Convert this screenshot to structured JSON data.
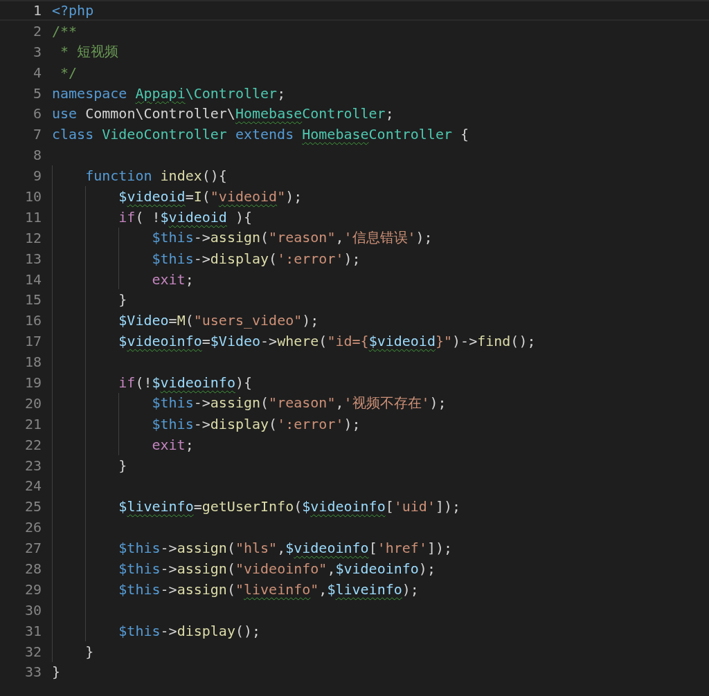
{
  "editor": {
    "lines": [
      {
        "number": "1",
        "current": true,
        "tokens": [
          {
            "text": "<?php",
            "kind": "kw"
          }
        ]
      },
      {
        "number": "2",
        "current": false,
        "tokens": [
          {
            "text": "/**",
            "kind": "cmt"
          }
        ]
      },
      {
        "number": "3",
        "current": false,
        "tokens": [
          {
            "text": " * 短视频",
            "kind": "cmt"
          }
        ]
      },
      {
        "number": "4",
        "current": false,
        "tokens": [
          {
            "text": " */",
            "kind": "cmt"
          }
        ]
      },
      {
        "number": "5",
        "current": false,
        "tokens": [
          {
            "text": "namespace ",
            "kind": "kw"
          },
          {
            "text": "Appapi",
            "kind": "cls",
            "squiggle": true
          },
          {
            "text": "\\Controller",
            "kind": "cls"
          },
          {
            "text": ";",
            "kind": "plain"
          }
        ]
      },
      {
        "number": "6",
        "current": false,
        "tokens": [
          {
            "text": "use ",
            "kind": "kw"
          },
          {
            "text": "Common\\Controller\\",
            "kind": "plain"
          },
          {
            "text": "Homebase",
            "kind": "cls",
            "squiggle": true
          },
          {
            "text": "Controller",
            "kind": "cls"
          },
          {
            "text": ";",
            "kind": "plain"
          }
        ]
      },
      {
        "number": "7",
        "current": false,
        "tokens": [
          {
            "text": "class ",
            "kind": "kw"
          },
          {
            "text": "VideoController ",
            "kind": "cls"
          },
          {
            "text": "extends ",
            "kind": "kw"
          },
          {
            "text": "Homebase",
            "kind": "cls",
            "squiggle": true
          },
          {
            "text": "Controller",
            "kind": "cls"
          },
          {
            "text": " {",
            "kind": "plain"
          }
        ]
      },
      {
        "number": "8",
        "current": false
      },
      {
        "number": "9",
        "current": false,
        "tokens": [
          {
            "text": "    function ",
            "kind": "kw"
          },
          {
            "text": "index",
            "kind": "fn"
          },
          {
            "text": "(){",
            "kind": "plain"
          }
        ]
      },
      {
        "number": "10",
        "current": false,
        "tokens": [
          {
            "text": "        $",
            "kind": "var"
          },
          {
            "text": "videoid",
            "kind": "var",
            "squiggle": true
          },
          {
            "text": "=",
            "kind": "plain"
          },
          {
            "text": "I",
            "kind": "fn"
          },
          {
            "text": "(",
            "kind": "plain"
          },
          {
            "text": "\"",
            "kind": "str"
          },
          {
            "text": "videoid",
            "kind": "str",
            "squiggle": true
          },
          {
            "text": "\"",
            "kind": "str"
          },
          {
            "text": ");",
            "kind": "plain"
          }
        ]
      },
      {
        "number": "11",
        "current": false,
        "tokens": [
          {
            "text": "        if",
            "kind": "ctl"
          },
          {
            "text": "( !",
            "kind": "plain"
          },
          {
            "text": "$",
            "kind": "var"
          },
          {
            "text": "videoid",
            "kind": "var",
            "squiggle": true
          },
          {
            "text": " ){",
            "kind": "plain"
          }
        ]
      },
      {
        "number": "12",
        "current": false,
        "tokens": [
          {
            "text": "            $this",
            "kind": "kw"
          },
          {
            "text": "->",
            "kind": "plain"
          },
          {
            "text": "assign",
            "kind": "fn"
          },
          {
            "text": "(",
            "kind": "plain"
          },
          {
            "text": "\"reason\"",
            "kind": "str"
          },
          {
            "text": ",",
            "kind": "plain"
          },
          {
            "text": "'信息错误'",
            "kind": "str"
          },
          {
            "text": ");",
            "kind": "plain"
          }
        ]
      },
      {
        "number": "13",
        "current": false,
        "tokens": [
          {
            "text": "            $this",
            "kind": "kw"
          },
          {
            "text": "->",
            "kind": "plain"
          },
          {
            "text": "display",
            "kind": "fn"
          },
          {
            "text": "(",
            "kind": "plain"
          },
          {
            "text": "':error'",
            "kind": "str"
          },
          {
            "text": ");",
            "kind": "plain"
          }
        ]
      },
      {
        "number": "14",
        "current": false,
        "tokens": [
          {
            "text": "            exit",
            "kind": "ctl"
          },
          {
            "text": ";",
            "kind": "plain"
          }
        ]
      },
      {
        "number": "15",
        "current": false,
        "tokens": [
          {
            "text": "        }",
            "kind": "plain"
          }
        ]
      },
      {
        "number": "16",
        "current": false,
        "tokens": [
          {
            "text": "        $Video",
            "kind": "var"
          },
          {
            "text": "=",
            "kind": "plain"
          },
          {
            "text": "M",
            "kind": "fn"
          },
          {
            "text": "(",
            "kind": "plain"
          },
          {
            "text": "\"users_video\"",
            "kind": "str"
          },
          {
            "text": ");",
            "kind": "plain"
          }
        ]
      },
      {
        "number": "17",
        "current": false,
        "tokens": [
          {
            "text": "        $",
            "kind": "var"
          },
          {
            "text": "videoinfo",
            "kind": "var",
            "squiggle": true
          },
          {
            "text": "=",
            "kind": "plain"
          },
          {
            "text": "$Video",
            "kind": "var"
          },
          {
            "text": "->",
            "kind": "plain"
          },
          {
            "text": "where",
            "kind": "fn"
          },
          {
            "text": "(",
            "kind": "plain"
          },
          {
            "text": "\"id={",
            "kind": "str"
          },
          {
            "text": "$videoid",
            "kind": "var",
            "squiggle": true
          },
          {
            "text": "}\"",
            "kind": "str"
          },
          {
            "text": ")->",
            "kind": "plain"
          },
          {
            "text": "find",
            "kind": "fn"
          },
          {
            "text": "();",
            "kind": "plain"
          }
        ]
      },
      {
        "number": "18",
        "current": false
      },
      {
        "number": "19",
        "current": false,
        "tokens": [
          {
            "text": "        if",
            "kind": "ctl"
          },
          {
            "text": "(!",
            "kind": "plain"
          },
          {
            "text": "$",
            "kind": "var"
          },
          {
            "text": "videoinfo",
            "kind": "var",
            "squiggle": true
          },
          {
            "text": "){",
            "kind": "plain"
          }
        ]
      },
      {
        "number": "20",
        "current": false,
        "tokens": [
          {
            "text": "            $this",
            "kind": "kw"
          },
          {
            "text": "->",
            "kind": "plain"
          },
          {
            "text": "assign",
            "kind": "fn"
          },
          {
            "text": "(",
            "kind": "plain"
          },
          {
            "text": "\"reason\"",
            "kind": "str"
          },
          {
            "text": ",",
            "kind": "plain"
          },
          {
            "text": "'视频不存在'",
            "kind": "str"
          },
          {
            "text": ");",
            "kind": "plain"
          }
        ]
      },
      {
        "number": "21",
        "current": false,
        "tokens": [
          {
            "text": "            $this",
            "kind": "kw"
          },
          {
            "text": "->",
            "kind": "plain"
          },
          {
            "text": "display",
            "kind": "fn"
          },
          {
            "text": "(",
            "kind": "plain"
          },
          {
            "text": "':error'",
            "kind": "str"
          },
          {
            "text": ");",
            "kind": "plain"
          }
        ]
      },
      {
        "number": "22",
        "current": false,
        "tokens": [
          {
            "text": "            exit",
            "kind": "ctl"
          },
          {
            "text": ";",
            "kind": "plain"
          }
        ]
      },
      {
        "number": "23",
        "current": false,
        "tokens": [
          {
            "text": "        }",
            "kind": "plain"
          }
        ]
      },
      {
        "number": "24",
        "current": false
      },
      {
        "number": "25",
        "current": false,
        "tokens": [
          {
            "text": "        $",
            "kind": "var"
          },
          {
            "text": "liveinfo",
            "kind": "var",
            "squiggle": true
          },
          {
            "text": "=",
            "kind": "plain"
          },
          {
            "text": "getUserInfo",
            "kind": "fn"
          },
          {
            "text": "(",
            "kind": "plain"
          },
          {
            "text": "$",
            "kind": "var"
          },
          {
            "text": "videoinfo",
            "kind": "var",
            "squiggle": true
          },
          {
            "text": "[",
            "kind": "plain"
          },
          {
            "text": "'uid'",
            "kind": "str"
          },
          {
            "text": "]);",
            "kind": "plain"
          }
        ]
      },
      {
        "number": "26",
        "current": false
      },
      {
        "number": "27",
        "current": false,
        "tokens": [
          {
            "text": "        $this",
            "kind": "kw"
          },
          {
            "text": "->",
            "kind": "plain"
          },
          {
            "text": "assign",
            "kind": "fn"
          },
          {
            "text": "(",
            "kind": "plain"
          },
          {
            "text": "\"hls\"",
            "kind": "str"
          },
          {
            "text": ",",
            "kind": "plain"
          },
          {
            "text": "$",
            "kind": "var"
          },
          {
            "text": "videoinfo",
            "kind": "var",
            "squiggle": true
          },
          {
            "text": "[",
            "kind": "plain"
          },
          {
            "text": "'href'",
            "kind": "str"
          },
          {
            "text": "]);",
            "kind": "plain"
          }
        ]
      },
      {
        "number": "28",
        "current": false,
        "tokens": [
          {
            "text": "        $this",
            "kind": "kw"
          },
          {
            "text": "->",
            "kind": "plain"
          },
          {
            "text": "assign",
            "kind": "fn"
          },
          {
            "text": "(",
            "kind": "plain"
          },
          {
            "text": "\"videoinfo\"",
            "kind": "str"
          },
          {
            "text": ",",
            "kind": "plain"
          },
          {
            "text": "$videoinfo",
            "kind": "var"
          },
          {
            "text": ");",
            "kind": "plain"
          }
        ]
      },
      {
        "number": "29",
        "current": false,
        "tokens": [
          {
            "text": "        $this",
            "kind": "kw"
          },
          {
            "text": "->",
            "kind": "plain"
          },
          {
            "text": "assign",
            "kind": "fn"
          },
          {
            "text": "(",
            "kind": "plain"
          },
          {
            "text": "\"",
            "kind": "str"
          },
          {
            "text": "liveinfo",
            "kind": "str",
            "squiggle": true
          },
          {
            "text": "\"",
            "kind": "str"
          },
          {
            "text": ",",
            "kind": "plain"
          },
          {
            "text": "$",
            "kind": "var"
          },
          {
            "text": "liveinfo",
            "kind": "var",
            "squiggle": true
          },
          {
            "text": ");",
            "kind": "plain"
          }
        ]
      },
      {
        "number": "30",
        "current": false
      },
      {
        "number": "31",
        "current": false,
        "tokens": [
          {
            "text": "        $this",
            "kind": "kw"
          },
          {
            "text": "->",
            "kind": "plain"
          },
          {
            "text": "display",
            "kind": "fn"
          },
          {
            "text": "();",
            "kind": "plain"
          }
        ]
      },
      {
        "number": "32",
        "current": false,
        "tokens": [
          {
            "text": "    }",
            "kind": "plain"
          }
        ]
      },
      {
        "number": "33",
        "current": false,
        "tokens": [
          {
            "text": "}",
            "kind": "plain"
          }
        ]
      }
    ]
  }
}
